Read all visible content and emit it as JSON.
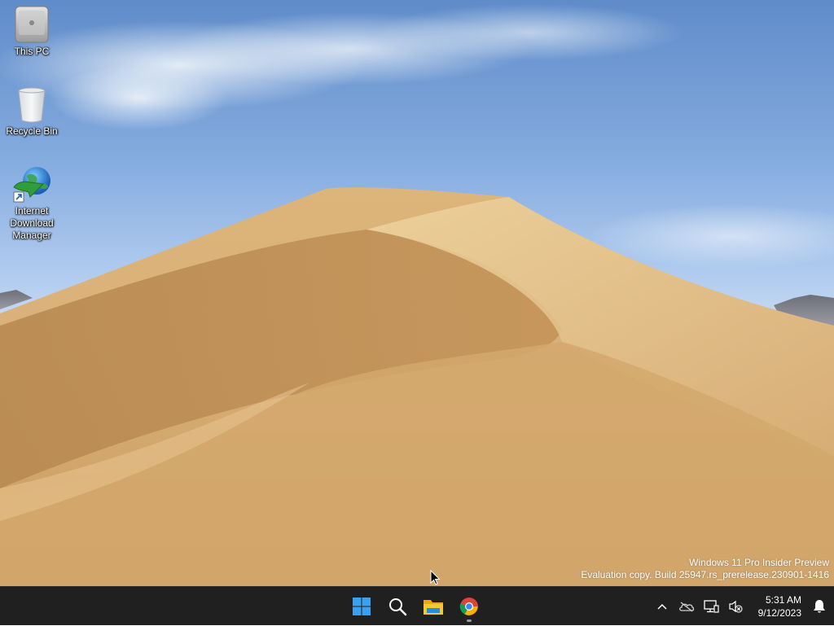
{
  "desktop": {
    "icons": [
      {
        "label": "This PC",
        "icon": "computer-icon"
      },
      {
        "label": "Recycle Bin",
        "icon": "recycle-bin-icon"
      },
      {
        "label": "Internet\nDownload\nManager",
        "icon": "internet-download-manager-icon"
      }
    ],
    "watermark": {
      "line1": "Windows 11 Pro Insider Preview",
      "line2": "Evaluation copy. Build 25947.rs_prerelease.230901-1416"
    }
  },
  "taskbar": {
    "pinned": [
      {
        "name": "Start",
        "icon": "windows-start-icon"
      },
      {
        "name": "Search",
        "icon": "search-icon"
      },
      {
        "name": "File Explorer",
        "icon": "folder-icon"
      },
      {
        "name": "Google Chrome",
        "icon": "chrome-icon",
        "running": true
      }
    ],
    "tray": {
      "icons": [
        "chevron-up-icon",
        "onedrive-offline-icon",
        "network-icon",
        "volume-muted-icon"
      ]
    },
    "clock": {
      "time": "5:31 AM",
      "date": "9/12/2023"
    },
    "notification_icon": "bell-icon"
  },
  "colors": {
    "taskbar_bg": "#202020",
    "start_blue": "#3aa0f0",
    "folder_yellow": "#f8c737"
  }
}
